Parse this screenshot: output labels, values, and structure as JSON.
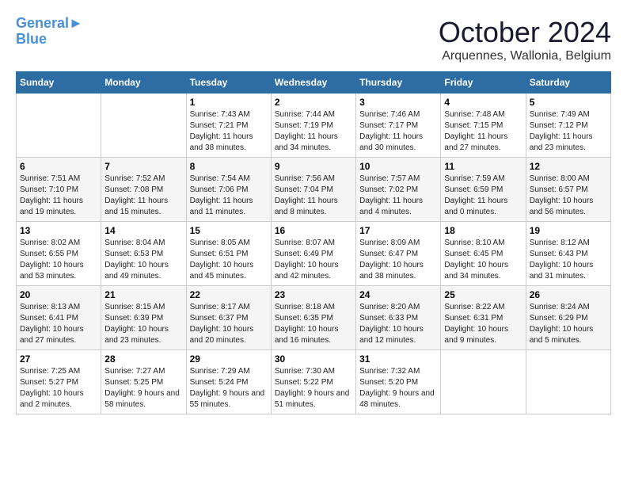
{
  "header": {
    "logo": {
      "line1": "General",
      "line2": "Blue"
    },
    "title": "October 2024",
    "subtitle": "Arquennes, Wallonia, Belgium"
  },
  "weekdays": [
    "Sunday",
    "Monday",
    "Tuesday",
    "Wednesday",
    "Thursday",
    "Friday",
    "Saturday"
  ],
  "weeks": [
    [
      {
        "day": "",
        "sunrise": "",
        "sunset": "",
        "daylight": ""
      },
      {
        "day": "",
        "sunrise": "",
        "sunset": "",
        "daylight": ""
      },
      {
        "day": "1",
        "sunrise": "Sunrise: 7:43 AM",
        "sunset": "Sunset: 7:21 PM",
        "daylight": "Daylight: 11 hours and 38 minutes."
      },
      {
        "day": "2",
        "sunrise": "Sunrise: 7:44 AM",
        "sunset": "Sunset: 7:19 PM",
        "daylight": "Daylight: 11 hours and 34 minutes."
      },
      {
        "day": "3",
        "sunrise": "Sunrise: 7:46 AM",
        "sunset": "Sunset: 7:17 PM",
        "daylight": "Daylight: 11 hours and 30 minutes."
      },
      {
        "day": "4",
        "sunrise": "Sunrise: 7:48 AM",
        "sunset": "Sunset: 7:15 PM",
        "daylight": "Daylight: 11 hours and 27 minutes."
      },
      {
        "day": "5",
        "sunrise": "Sunrise: 7:49 AM",
        "sunset": "Sunset: 7:12 PM",
        "daylight": "Daylight: 11 hours and 23 minutes."
      }
    ],
    [
      {
        "day": "6",
        "sunrise": "Sunrise: 7:51 AM",
        "sunset": "Sunset: 7:10 PM",
        "daylight": "Daylight: 11 hours and 19 minutes."
      },
      {
        "day": "7",
        "sunrise": "Sunrise: 7:52 AM",
        "sunset": "Sunset: 7:08 PM",
        "daylight": "Daylight: 11 hours and 15 minutes."
      },
      {
        "day": "8",
        "sunrise": "Sunrise: 7:54 AM",
        "sunset": "Sunset: 7:06 PM",
        "daylight": "Daylight: 11 hours and 11 minutes."
      },
      {
        "day": "9",
        "sunrise": "Sunrise: 7:56 AM",
        "sunset": "Sunset: 7:04 PM",
        "daylight": "Daylight: 11 hours and 8 minutes."
      },
      {
        "day": "10",
        "sunrise": "Sunrise: 7:57 AM",
        "sunset": "Sunset: 7:02 PM",
        "daylight": "Daylight: 11 hours and 4 minutes."
      },
      {
        "day": "11",
        "sunrise": "Sunrise: 7:59 AM",
        "sunset": "Sunset: 6:59 PM",
        "daylight": "Daylight: 11 hours and 0 minutes."
      },
      {
        "day": "12",
        "sunrise": "Sunrise: 8:00 AM",
        "sunset": "Sunset: 6:57 PM",
        "daylight": "Daylight: 10 hours and 56 minutes."
      }
    ],
    [
      {
        "day": "13",
        "sunrise": "Sunrise: 8:02 AM",
        "sunset": "Sunset: 6:55 PM",
        "daylight": "Daylight: 10 hours and 53 minutes."
      },
      {
        "day": "14",
        "sunrise": "Sunrise: 8:04 AM",
        "sunset": "Sunset: 6:53 PM",
        "daylight": "Daylight: 10 hours and 49 minutes."
      },
      {
        "day": "15",
        "sunrise": "Sunrise: 8:05 AM",
        "sunset": "Sunset: 6:51 PM",
        "daylight": "Daylight: 10 hours and 45 minutes."
      },
      {
        "day": "16",
        "sunrise": "Sunrise: 8:07 AM",
        "sunset": "Sunset: 6:49 PM",
        "daylight": "Daylight: 10 hours and 42 minutes."
      },
      {
        "day": "17",
        "sunrise": "Sunrise: 8:09 AM",
        "sunset": "Sunset: 6:47 PM",
        "daylight": "Daylight: 10 hours and 38 minutes."
      },
      {
        "day": "18",
        "sunrise": "Sunrise: 8:10 AM",
        "sunset": "Sunset: 6:45 PM",
        "daylight": "Daylight: 10 hours and 34 minutes."
      },
      {
        "day": "19",
        "sunrise": "Sunrise: 8:12 AM",
        "sunset": "Sunset: 6:43 PM",
        "daylight": "Daylight: 10 hours and 31 minutes."
      }
    ],
    [
      {
        "day": "20",
        "sunrise": "Sunrise: 8:13 AM",
        "sunset": "Sunset: 6:41 PM",
        "daylight": "Daylight: 10 hours and 27 minutes."
      },
      {
        "day": "21",
        "sunrise": "Sunrise: 8:15 AM",
        "sunset": "Sunset: 6:39 PM",
        "daylight": "Daylight: 10 hours and 23 minutes."
      },
      {
        "day": "22",
        "sunrise": "Sunrise: 8:17 AM",
        "sunset": "Sunset: 6:37 PM",
        "daylight": "Daylight: 10 hours and 20 minutes."
      },
      {
        "day": "23",
        "sunrise": "Sunrise: 8:18 AM",
        "sunset": "Sunset: 6:35 PM",
        "daylight": "Daylight: 10 hours and 16 minutes."
      },
      {
        "day": "24",
        "sunrise": "Sunrise: 8:20 AM",
        "sunset": "Sunset: 6:33 PM",
        "daylight": "Daylight: 10 hours and 12 minutes."
      },
      {
        "day": "25",
        "sunrise": "Sunrise: 8:22 AM",
        "sunset": "Sunset: 6:31 PM",
        "daylight": "Daylight: 10 hours and 9 minutes."
      },
      {
        "day": "26",
        "sunrise": "Sunrise: 8:24 AM",
        "sunset": "Sunset: 6:29 PM",
        "daylight": "Daylight: 10 hours and 5 minutes."
      }
    ],
    [
      {
        "day": "27",
        "sunrise": "Sunrise: 7:25 AM",
        "sunset": "Sunset: 5:27 PM",
        "daylight": "Daylight: 10 hours and 2 minutes."
      },
      {
        "day": "28",
        "sunrise": "Sunrise: 7:27 AM",
        "sunset": "Sunset: 5:25 PM",
        "daylight": "Daylight: 9 hours and 58 minutes."
      },
      {
        "day": "29",
        "sunrise": "Sunrise: 7:29 AM",
        "sunset": "Sunset: 5:24 PM",
        "daylight": "Daylight: 9 hours and 55 minutes."
      },
      {
        "day": "30",
        "sunrise": "Sunrise: 7:30 AM",
        "sunset": "Sunset: 5:22 PM",
        "daylight": "Daylight: 9 hours and 51 minutes."
      },
      {
        "day": "31",
        "sunrise": "Sunrise: 7:32 AM",
        "sunset": "Sunset: 5:20 PM",
        "daylight": "Daylight: 9 hours and 48 minutes."
      },
      {
        "day": "",
        "sunrise": "",
        "sunset": "",
        "daylight": ""
      },
      {
        "day": "",
        "sunrise": "",
        "sunset": "",
        "daylight": ""
      }
    ]
  ]
}
